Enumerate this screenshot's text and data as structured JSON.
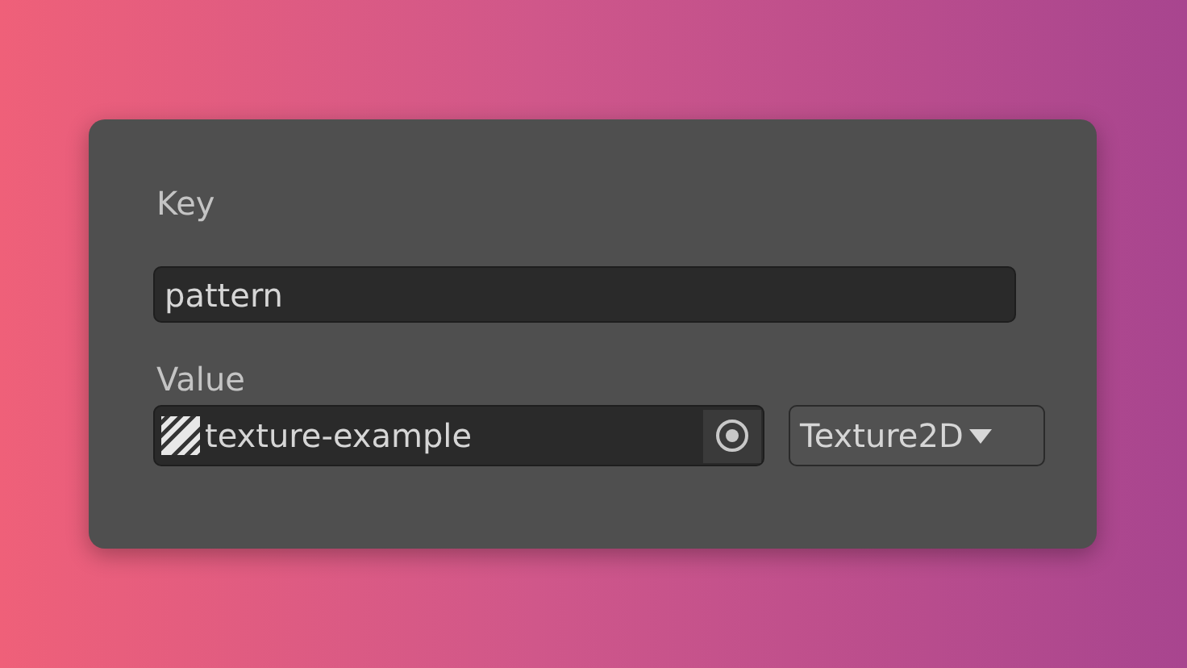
{
  "key": {
    "label": "Key",
    "value": "pattern"
  },
  "value": {
    "label": "Value",
    "object": "texture-example",
    "type": "Texture2D"
  }
}
